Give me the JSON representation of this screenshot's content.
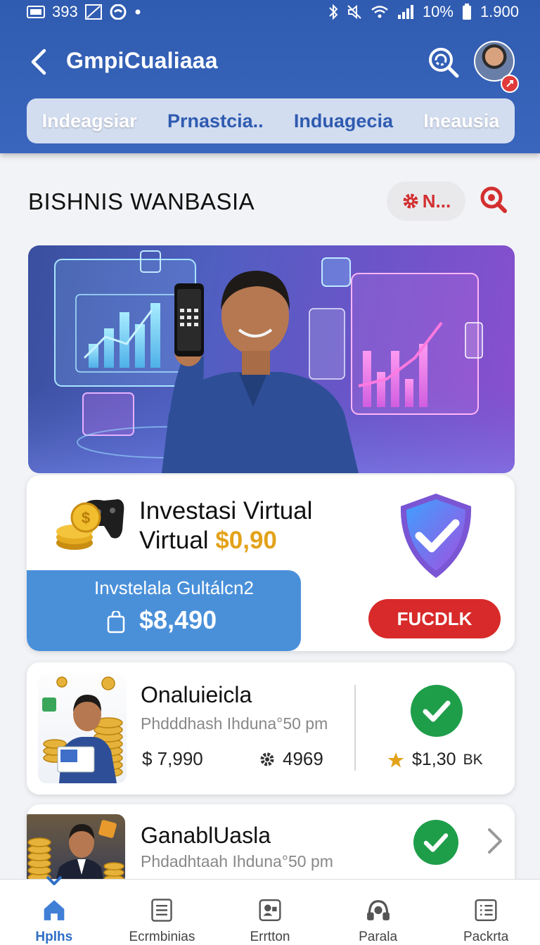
{
  "status_bar": {
    "time": "393",
    "battery": "10%",
    "right_time": "1.900"
  },
  "header": {
    "title": "GmpiCualiaaa",
    "tabs": [
      "Indeagsiar",
      "Prnastcia..",
      "Induagecia",
      "Ineausia"
    ],
    "active_tab_index": 1
  },
  "section": {
    "title": "BISHNIS WANBASIA",
    "filter_label": "N..."
  },
  "card1": {
    "title_line1": "Investasi Virtual",
    "title_line2": "Virtual",
    "price": "$0,90",
    "blue_label": "Invstelala Gultálcn2",
    "amount": "$8,490",
    "button_label": "FUCDLK"
  },
  "card2": {
    "title": "Onaluieicla",
    "subtitle": "Phdddhash Ihduna°50 pm",
    "price": "$ 7,990",
    "rating": "4969",
    "reward": "$1,30",
    "reward_suffix": "BK"
  },
  "card3": {
    "title": "GanablUasla",
    "subtitle": "Phdadhtaah Ihduna°50 pm"
  },
  "bottom_nav": {
    "items": [
      "Hplhs",
      "Ecrmbinias",
      "Errtton",
      "Parala",
      "Packrta"
    ],
    "active_index": 0
  },
  "colors": {
    "header_blue": "#2f5bb0",
    "accent_red": "#d82a2a",
    "success_green": "#1f9e4a",
    "price_gold": "#e3a21a",
    "card_blue": "#4a90d9"
  }
}
